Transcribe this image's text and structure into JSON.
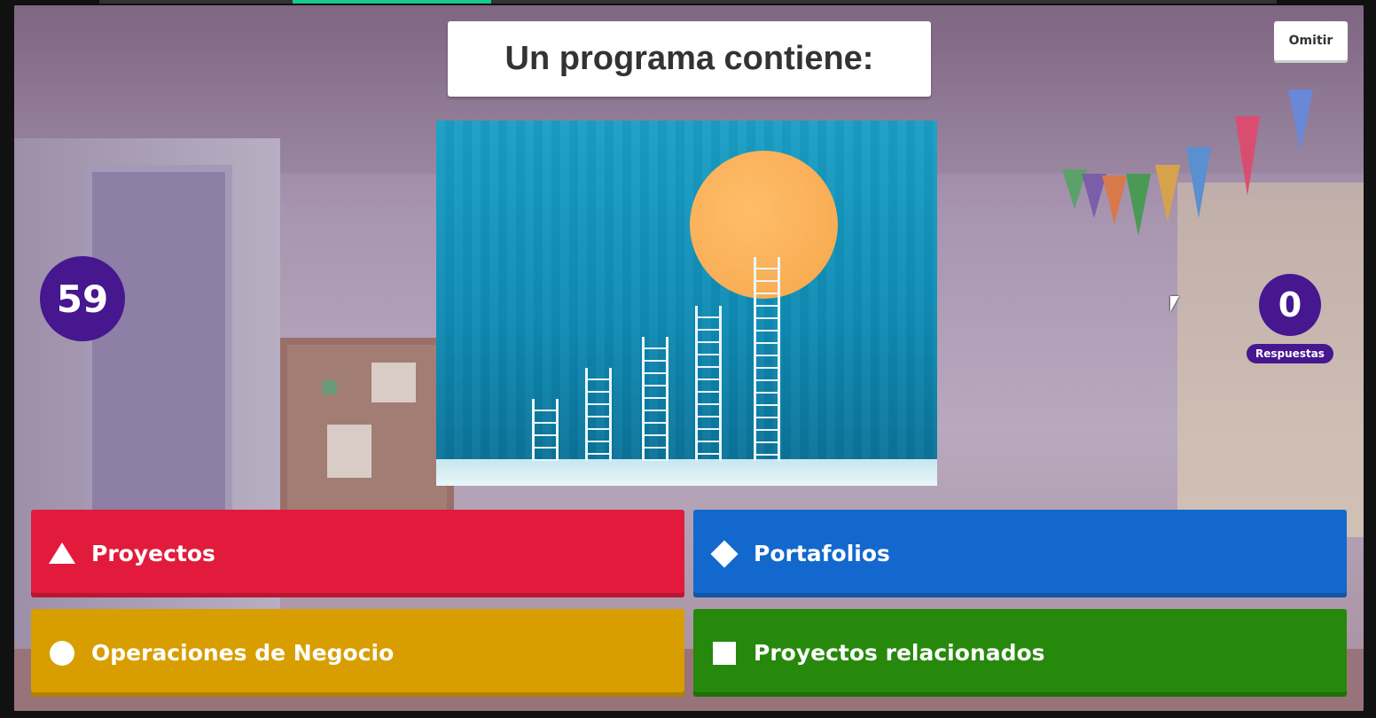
{
  "question": {
    "title": "Un programa contiene:"
  },
  "controls": {
    "skip_label": "Omitir"
  },
  "timer": {
    "value": "59"
  },
  "answers_counter": {
    "count": "0",
    "label": "Respuestas"
  },
  "answers": [
    {
      "label": "Proyectos",
      "shape": "triangle-icon",
      "color": "#e21b3c"
    },
    {
      "label": "Portafolios",
      "shape": "diamond-icon",
      "color": "#1368ce"
    },
    {
      "label": "Operaciones de Negocio",
      "shape": "circle-icon",
      "color": "#d89e00"
    },
    {
      "label": "Proyectos relacionados",
      "shape": "square-icon",
      "color": "#26890c"
    }
  ],
  "colors": {
    "accent": "#46178f"
  }
}
